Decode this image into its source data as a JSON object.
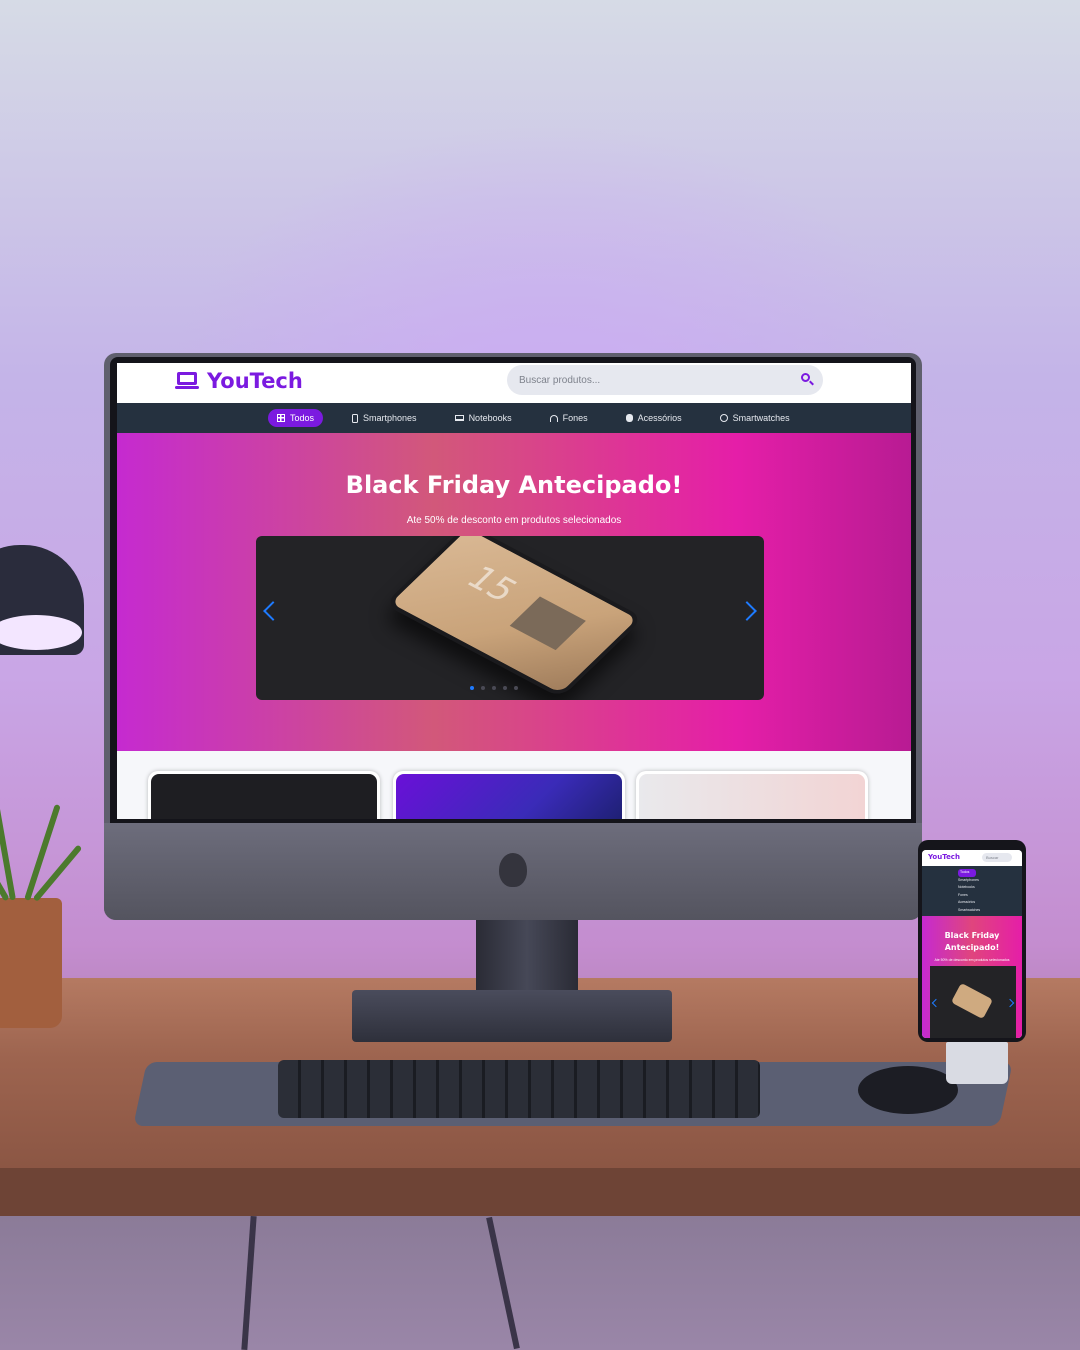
{
  "brand": {
    "name": "YouTech",
    "accent": "#7b1ae0"
  },
  "search": {
    "placeholder": "Buscar produtos..."
  },
  "nav": {
    "items": [
      {
        "label": "Todos",
        "icon": "grid-icon",
        "active": true
      },
      {
        "label": "Smartphones",
        "icon": "phone-icon",
        "active": false
      },
      {
        "label": "Notebooks",
        "icon": "laptop-icon",
        "active": false
      },
      {
        "label": "Fones",
        "icon": "headphones-icon",
        "active": false
      },
      {
        "label": "Acessórios",
        "icon": "accessory-icon",
        "active": false
      },
      {
        "label": "Smartwatches",
        "icon": "clock-icon",
        "active": false
      }
    ]
  },
  "hero": {
    "title": "Black Friday Antecipado!",
    "subtitle": "Ate 50% de desconto em produtos selecionados",
    "slide_text": "15",
    "slides_count": 1,
    "active_slide": 1
  },
  "mobile": {
    "brand": "YouTech",
    "search_placeholder": "Buscar",
    "nav_items": [
      "Todos",
      "Smartphones",
      "Notebooks",
      "Fones",
      "Acessórios",
      "Smartwatches"
    ],
    "hero_title": "Black Friday Antecipado!",
    "hero_subtitle": "Ate 50% de desconto em produtos selecionados"
  }
}
